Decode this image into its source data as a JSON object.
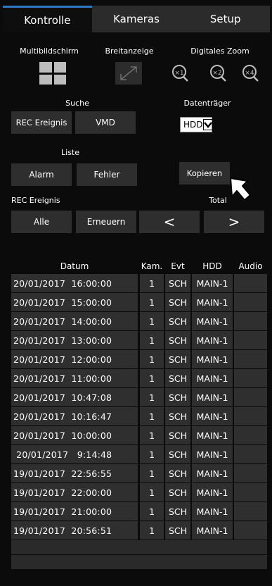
{
  "tabs": [
    {
      "label": "Kontrolle",
      "active": true
    },
    {
      "label": "Kameras",
      "active": false
    },
    {
      "label": "Setup",
      "active": false
    }
  ],
  "display": {
    "multiscreen_label": "Multibildschirm",
    "wide_label": "Breitanzeige",
    "zoom_label": "Digitales Zoom",
    "zoom_levels": [
      "×1",
      "×2",
      "×4"
    ]
  },
  "search": {
    "label": "Suche",
    "rec_event_button": "REC Ereignis",
    "vmd_button": "VMD"
  },
  "media": {
    "label": "Datenträger",
    "selected": "HDD"
  },
  "list": {
    "label": "Liste",
    "alarm_button": "Alarm",
    "error_button": "Fehler",
    "copy_button": "Kopieren"
  },
  "rec_event_label": "REC Ereignis",
  "total_label": "Total",
  "nav": {
    "all_button": "Alle",
    "refresh_button": "Erneuern",
    "prev_symbol": "<",
    "next_symbol": ">"
  },
  "table": {
    "headers": [
      "Datum",
      "Kam.",
      "Evt",
      "HDD",
      "Audio"
    ],
    "rows": [
      {
        "date": "20/01/2017  16:00:00",
        "cam": "1",
        "evt": "SCH",
        "hdd": "MAIN-1",
        "audio": ""
      },
      {
        "date": "20/01/2017  15:00:00",
        "cam": "1",
        "evt": "SCH",
        "hdd": "MAIN-1",
        "audio": ""
      },
      {
        "date": "20/01/2017  14:00:00",
        "cam": "1",
        "evt": "SCH",
        "hdd": "MAIN-1",
        "audio": ""
      },
      {
        "date": "20/01/2017  13:00:00",
        "cam": "1",
        "evt": "SCH",
        "hdd": "MAIN-1",
        "audio": ""
      },
      {
        "date": "20/01/2017  12:00:00",
        "cam": "1",
        "evt": "SCH",
        "hdd": "MAIN-1",
        "audio": ""
      },
      {
        "date": "20/01/2017  11:00:00",
        "cam": "1",
        "evt": "SCH",
        "hdd": "MAIN-1",
        "audio": ""
      },
      {
        "date": "20/01/2017  10:47:08",
        "cam": "1",
        "evt": "SCH",
        "hdd": "MAIN-1",
        "audio": ""
      },
      {
        "date": "20/01/2017  10:16:47",
        "cam": "1",
        "evt": "SCH",
        "hdd": "MAIN-1",
        "audio": ""
      },
      {
        "date": "20/01/2017  10:00:00",
        "cam": "1",
        "evt": "SCH",
        "hdd": "MAIN-1",
        "audio": ""
      },
      {
        "date": " 20/01/2017   9:14:48",
        "cam": "1",
        "evt": "SCH",
        "hdd": "MAIN-1",
        "audio": ""
      },
      {
        "date": "19/01/2017  22:56:55",
        "cam": "1",
        "evt": "SCH",
        "hdd": "MAIN-1",
        "audio": ""
      },
      {
        "date": "19/01/2017  22:00:00",
        "cam": "1",
        "evt": "SCH",
        "hdd": "MAIN-1",
        "audio": ""
      },
      {
        "date": "19/01/2017  21:00:00",
        "cam": "1",
        "evt": "SCH",
        "hdd": "MAIN-1",
        "audio": ""
      },
      {
        "date": "19/01/2017  20:56:51",
        "cam": "1",
        "evt": "SCH",
        "hdd": "MAIN-1",
        "audio": ""
      }
    ],
    "empty_rows": 2
  },
  "colors": {
    "accent": "#2f78c4",
    "background": "#0b0b0b",
    "button": "#2e2e2e"
  },
  "icons": [
    "quad-layout-icon",
    "wide-view-icon",
    "zoom-x1-icon",
    "zoom-x2-icon",
    "zoom-x4-icon",
    "dropdown-arrow-icon",
    "mouse-cursor-icon"
  ]
}
